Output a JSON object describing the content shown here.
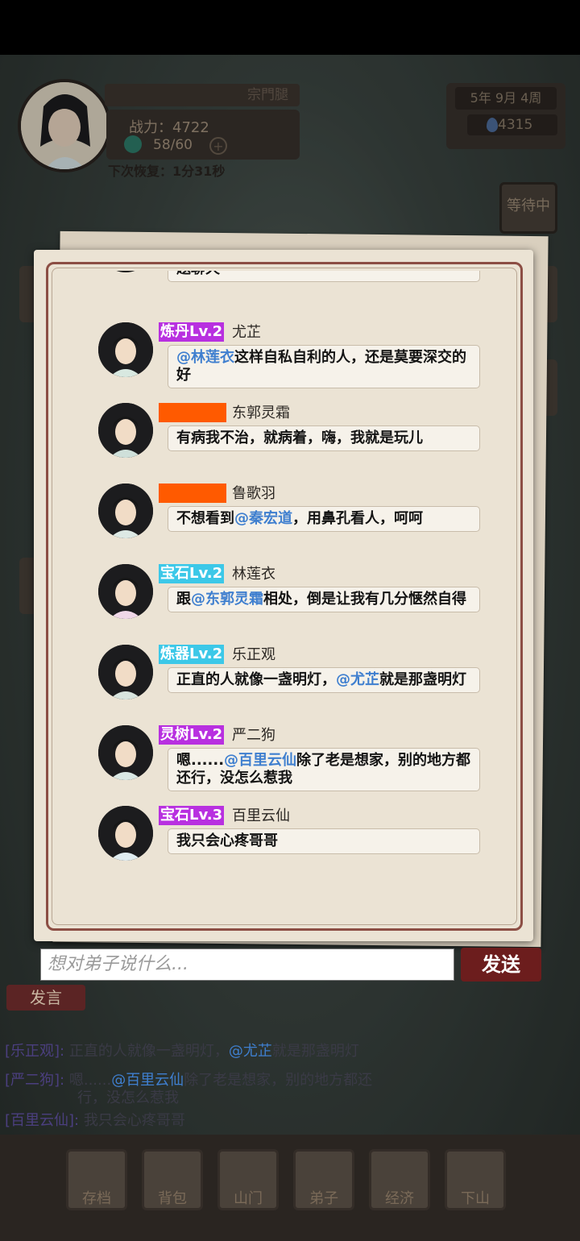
{
  "hud": {
    "name": "宗門腿",
    "power": "战力：4722",
    "stamina": "58/60",
    "recover": "下次恢复：1分31秒",
    "date": "5年  9月  4周",
    "gems": "4315",
    "waiting": "等待中"
  },
  "chat": {
    "top_partial": "题聊天",
    "messages": [
      {
        "tag": "炼丹Lv.2",
        "tag_color": "#b830e0",
        "name": "尤芷",
        "parts": [
          {
            "m": true,
            "t": "@林莲衣"
          },
          {
            "m": false,
            "t": "这样自私自利的人，还是莫要深交的好"
          }
        ]
      },
      {
        "tag": "",
        "tag_color": "#ff5a00",
        "name": "东郭灵霜",
        "parts": [
          {
            "m": false,
            "t": "有病我不治，就病着，嗨，我就是玩儿"
          }
        ]
      },
      {
        "tag": "",
        "tag_color": "#ff5a00",
        "name": "鲁歌羽",
        "parts": [
          {
            "m": false,
            "t": "不想看到"
          },
          {
            "m": true,
            "t": "@秦宏道"
          },
          {
            "m": false,
            "t": "，用鼻孔看人，呵呵"
          }
        ]
      },
      {
        "tag": "宝石Lv.2",
        "tag_color": "#3cc8e8",
        "name": "林莲衣",
        "parts": [
          {
            "m": false,
            "t": "跟"
          },
          {
            "m": true,
            "t": "@东郭灵霜"
          },
          {
            "m": false,
            "t": "相处，倒是让我有几分惬然自得"
          }
        ]
      },
      {
        "tag": "炼器Lv.2",
        "tag_color": "#3cc8e8",
        "name": "乐正观",
        "parts": [
          {
            "m": false,
            "t": "正直的人就像一盏明灯，"
          },
          {
            "m": true,
            "t": "@尤芷"
          },
          {
            "m": false,
            "t": "就是那盏明灯"
          }
        ]
      },
      {
        "tag": "灵树Lv.2",
        "tag_color": "#b830e0",
        "name": "严二狗",
        "parts": [
          {
            "m": false,
            "t": "嗯......"
          },
          {
            "m": true,
            "t": "@百里云仙"
          },
          {
            "m": false,
            "t": "除了老是想家，别的地方都还行，没怎么惹我"
          }
        ]
      },
      {
        "tag": "宝石Lv.3",
        "tag_color": "#b830e0",
        "name": "百里云仙",
        "parts": [
          {
            "m": false,
            "t": "我只会心疼哥哥"
          }
        ]
      }
    ]
  },
  "input": {
    "placeholder": "想对弟子说什么..."
  },
  "send_label": "发送",
  "speak_label": "发言",
  "log": [
    {
      "who": "[乐正观]:",
      "pre": "正直的人就像一盏明灯，",
      "mention": "@尤芷",
      "post": "就是那盏明灯"
    },
    {
      "who": "[严二狗]:",
      "pre": "嗯......",
      "mention": "@百里云仙",
      "post": "除了老是想家，别的地方都还"
    },
    {
      "who": "",
      "pre": "行，没怎么惹我",
      "mention": "",
      "post": ""
    },
    {
      "who": "[百里云仙]:",
      "pre": "我只会心疼哥哥",
      "mention": "",
      "post": ""
    }
  ],
  "nav": [
    "存档",
    "背包",
    "山门",
    "弟子",
    "经济",
    "下山"
  ],
  "icons": [
    "stamina-icon",
    "gem-icon",
    "plus-icon"
  ]
}
